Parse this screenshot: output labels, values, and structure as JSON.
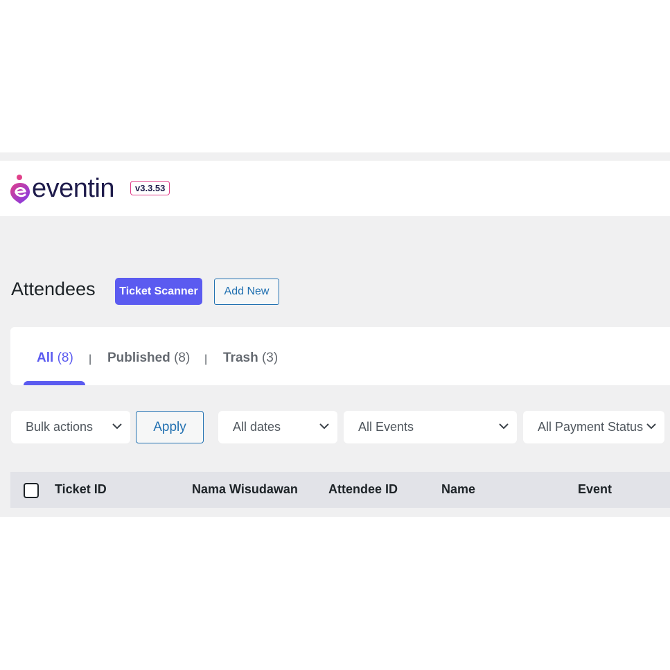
{
  "brand": {
    "name": "eventin",
    "version": "v3.3.53",
    "colors": {
      "accent": "#5b5bf0",
      "logo_pink": "#e0408a",
      "logo_purple": "#7c3aed",
      "text_dark": "#1e1b4b"
    }
  },
  "header": {
    "title": "Attendees",
    "ticket_scanner_label": "Ticket Scanner",
    "add_new_label": "Add New"
  },
  "tabs": [
    {
      "label": "All",
      "count": "(8)",
      "active": true
    },
    {
      "label": "Published",
      "count": "(8)",
      "active": false
    },
    {
      "label": "Trash",
      "count": "(3)",
      "active": false
    }
  ],
  "tab_separator": "|",
  "filters": {
    "bulk_actions": "Bulk actions",
    "apply_label": "Apply",
    "dates": "All dates",
    "events": "All Events",
    "payment_status": "All Payment Status"
  },
  "table": {
    "columns": [
      "Ticket ID",
      "Nama Wisudawan",
      "Attendee ID",
      "Name",
      "Event"
    ]
  },
  "icons": {
    "logo": "eventin-logo-icon",
    "dropdown": "chevron-down-icon"
  }
}
